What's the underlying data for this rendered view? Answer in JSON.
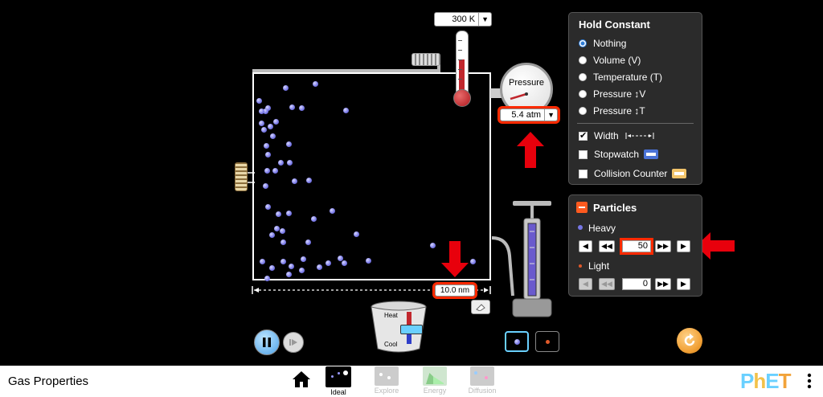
{
  "temperature": {
    "value": "300 K"
  },
  "pressure": {
    "gauge_label": "Pressure",
    "value": "5.4 atm"
  },
  "width_readout": {
    "value": "10.0 nm"
  },
  "heater": {
    "heat_label": "Heat",
    "cool_label": "Cool"
  },
  "hold_constant": {
    "title": "Hold Constant",
    "options": [
      {
        "label": "Nothing",
        "selected": true
      },
      {
        "label": "Volume (V)",
        "selected": false
      },
      {
        "label": "Temperature (T)",
        "selected": false
      },
      {
        "label": "Pressure ↕V",
        "selected": false
      },
      {
        "label": "Pressure ↕T",
        "selected": false
      }
    ],
    "checks": [
      {
        "label": "Width",
        "checked": true
      },
      {
        "label": "Stopwatch",
        "checked": false
      },
      {
        "label": "Collision Counter",
        "checked": false
      }
    ]
  },
  "particles": {
    "title": "Particles",
    "heavy_label": "Heavy",
    "heavy_count": "50",
    "light_label": "Light",
    "light_count": "0"
  },
  "app": {
    "title": "Gas Properties",
    "logo": "PhET"
  },
  "screens": [
    {
      "label": "Ideal",
      "active": true
    },
    {
      "label": "Explore",
      "active": false
    },
    {
      "label": "Energy",
      "active": false
    },
    {
      "label": "Diffusion",
      "active": false
    }
  ],
  "colors": {
    "highlight": "#ff2a00",
    "heavy_particle": "#7777e6",
    "light_particle": "#e0592a",
    "reset": "#f2a33a"
  }
}
